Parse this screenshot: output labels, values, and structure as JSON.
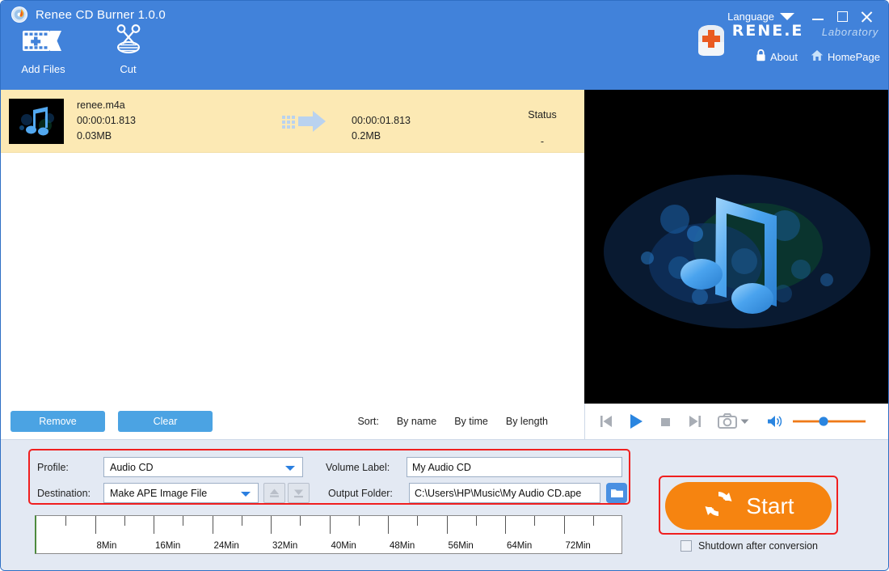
{
  "window": {
    "title": "Renee CD Burner 1.0.0",
    "app_icon": "cd-flame-icon",
    "language_label": "Language",
    "minimize": "minimize-button",
    "maximize": "maximize-button",
    "close": "close-button",
    "accent_blue": "#4182da",
    "panel_bg": "#e3e9f3",
    "highlight_row": "#fce9b4",
    "start_orange": "#f68410",
    "outline_red": "#f01f1f"
  },
  "brand": {
    "name": "RENE.E",
    "sub": "Laboratory",
    "about": "About",
    "about_icon": "lock-icon",
    "homepage": "HomePage",
    "homepage_icon": "home-icon"
  },
  "toolbar": {
    "items": [
      {
        "label": "Add Files",
        "icon": "add-files-icon",
        "has_caret": true
      },
      {
        "label": "Cut",
        "icon": "scissors-icon",
        "has_caret": false
      }
    ]
  },
  "file_list": {
    "status_header": "Status",
    "rows": [
      {
        "name": "renee.m4a",
        "duration": "00:00:01.813",
        "size": "0.03MB",
        "out_duration": "00:00:01.813",
        "out_size": "0.2MB",
        "status": "-",
        "thumb": "music-note-thumbnail"
      }
    ]
  },
  "list_toolbar": {
    "remove": "Remove",
    "clear": "Clear",
    "sort_label": "Sort:",
    "sort_options": [
      "By name",
      "By time",
      "By length"
    ]
  },
  "player": {
    "prev": "previous-track-icon",
    "play": "play-icon",
    "stop": "stop-icon",
    "next": "next-track-icon",
    "snapshot": "camera-icon",
    "volume": "volume-icon",
    "volume_value": 42
  },
  "settings": {
    "profile_label": "Profile:",
    "profile_value": "Audio CD",
    "destination_label": "Destination:",
    "destination_value": "Make APE Image File",
    "eject_up": "eject-up-button",
    "eject_down": "eject-down-button",
    "volume_label_label": "Volume Label:",
    "volume_label_value": "My Audio CD",
    "output_folder_label": "Output Folder:",
    "output_folder_value": "C:\\Users\\HP\\Music\\My Audio CD.ape",
    "browse_icon": "folder-icon"
  },
  "ruler": {
    "labels": [
      "8Min",
      "16Min",
      "24Min",
      "32Min",
      "40Min",
      "48Min",
      "56Min",
      "64Min",
      "72Min"
    ],
    "max_min": 80
  },
  "actions": {
    "start": "Start",
    "start_icon": "refresh-circle-icon",
    "shutdown": "Shutdown after conversion",
    "shutdown_checked": false
  }
}
